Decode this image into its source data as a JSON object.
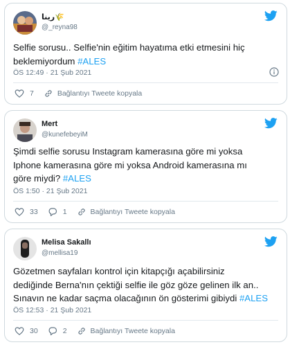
{
  "tweets": [
    {
      "name": "رينا🌾",
      "handle": "@_reyna98",
      "text": "Selfie sorusu.. Selfie'nin eğitim hayatıma etki etmesini hiç\nbeklemiyordum ",
      "hashtag": "#ALES",
      "time": "ÖS 12:49 · 21 Şub 2021",
      "likes": "7",
      "replies": "",
      "copy_label": "Bağlantıyı Tweete kopyala"
    },
    {
      "name": "Mert",
      "handle": "@kunefebeyiM",
      "text": "Şimdi selfie sorusu Instagram kamerasına göre mi yoksa\nIphone kamerasına göre mi yoksa Android kamerasına mı\ngöre miydi?  ",
      "hashtag": "#ALES",
      "time": "ÖS 1:50 · 21 Şub 2021",
      "likes": "33",
      "replies": "1",
      "copy_label": "Bağlantıyı Tweete kopyala"
    },
    {
      "name": "Melisa Sakallı",
      "handle": "@mellisa19",
      "text": "Gözetmen sayfaları kontrol için kitapçığı açabilirsiniz\ndediğinde Berna'nın çektiği selfie ile göz göze gelinen ilk an..\nSınavın ne kadar saçma olacağının ön gösterimi gibiydi ",
      "hashtag": "#ALES",
      "time": "ÖS 12:53 · 21 Şub 2021",
      "likes": "30",
      "replies": "2",
      "copy_label": "Bağlantıyı Tweete kopyala"
    }
  ],
  "icons": {
    "brand": "twitter-bird-icon",
    "like": "heart-icon",
    "reply": "reply-bubble-icon",
    "copy": "link-icon",
    "info": "info-icon"
  },
  "colors": {
    "brand": "#1da1f2",
    "text": "#14171a",
    "muted": "#657786",
    "border": "#cfd9de",
    "like_icon": "#657786"
  }
}
